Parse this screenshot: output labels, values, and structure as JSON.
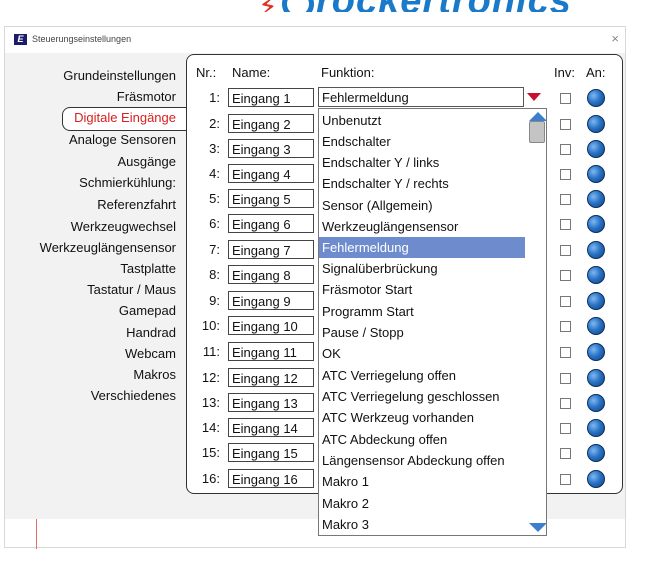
{
  "brand": {
    "text": "rockertronics"
  },
  "window": {
    "title": "Steuerungseinstellungen",
    "close_glyph": "×"
  },
  "nav": {
    "items": [
      "Grundeinstellungen",
      "Fräsmotor",
      "Digitale Eingänge",
      "Analoge Sensoren",
      "Ausgänge",
      "Schmierkühlung:",
      "Referenzfahrt",
      "Werkzeugwechsel",
      "Werkzeuglängensensor",
      "Tastplatte",
      "Tastatur / Maus",
      "Gamepad",
      "Handrad",
      "Webcam",
      "Makros",
      "Verschiedenes"
    ],
    "active_index": 2
  },
  "table": {
    "headers": {
      "nr": "Nr.:",
      "name": "Name:",
      "function": "Funktion:",
      "inv": "Inv:",
      "on": "An:"
    },
    "rows": [
      {
        "nr": "1:",
        "name": "Eingang 1"
      },
      {
        "nr": "2:",
        "name": "Eingang 2"
      },
      {
        "nr": "3:",
        "name": "Eingang 3"
      },
      {
        "nr": "4:",
        "name": "Eingang 4"
      },
      {
        "nr": "5:",
        "name": "Eingang 5"
      },
      {
        "nr": "6:",
        "name": "Eingang 6"
      },
      {
        "nr": "7:",
        "name": "Eingang 7"
      },
      {
        "nr": "8:",
        "name": "Eingang 8"
      },
      {
        "nr": "9:",
        "name": "Eingang 9"
      },
      {
        "nr": "10:",
        "name": "Eingang 10"
      },
      {
        "nr": "11:",
        "name": "Eingang 11"
      },
      {
        "nr": "12:",
        "name": "Eingang 12"
      },
      {
        "nr": "13:",
        "name": "Eingang 13"
      },
      {
        "nr": "14:",
        "name": "Eingang 14"
      },
      {
        "nr": "15:",
        "name": "Eingang 15"
      },
      {
        "nr": "16:",
        "name": "Eingang 16"
      }
    ]
  },
  "function_select": {
    "value": "Fehlermeldung",
    "options": [
      "Unbenutzt",
      "Endschalter",
      "Endschalter Y / links",
      "Endschalter Y / rechts",
      "Sensor (Allgemein)",
      "Werkzeuglängensensor",
      "Fehlermeldung",
      "Signalüberbrückung",
      "Fräsmotor Start",
      "Programm Start",
      "Pause / Stopp",
      "OK",
      "ATC Verriegelung offen",
      "ATC Verriegelung geschlossen",
      "ATC Werkzeug vorhanden",
      "ATC Abdeckung offen",
      "Längensensor Abdeckung offen",
      "Makro 1",
      "Makro 2",
      "Makro 3"
    ],
    "selected_index": 6
  },
  "colors": {
    "accent_red": "#d82020",
    "selection": "#6e8ccd",
    "led_blue": "#2a74c6",
    "brand_blue": "#1a79c8"
  }
}
